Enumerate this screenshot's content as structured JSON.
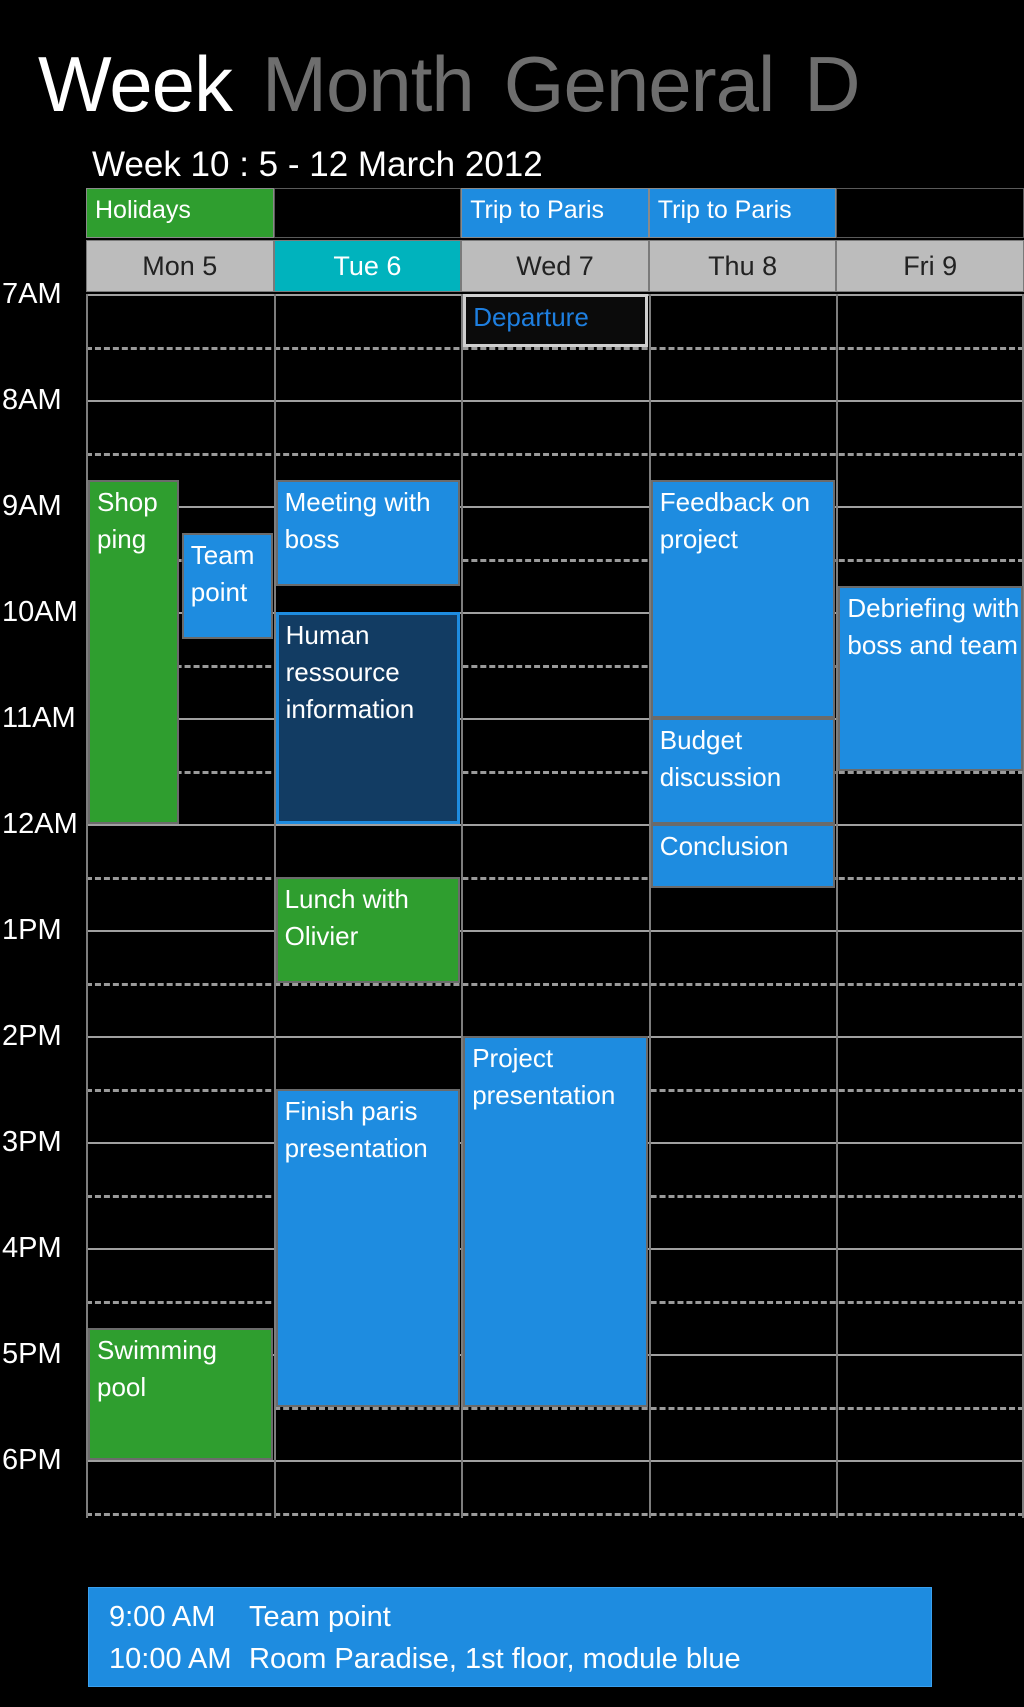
{
  "view_tabs": [
    {
      "label": "Week",
      "state": "active"
    },
    {
      "label": "Month",
      "state": "inactive"
    },
    {
      "label": "General",
      "state": "inactive"
    },
    {
      "label": "D",
      "state": "inactive"
    }
  ],
  "week_subtitle": "Week 10 : 5 - 12 March 2012",
  "colors": {
    "event_blue": "#1e8ce0",
    "event_green": "#2f9e2f",
    "event_navy": "#123c63",
    "today_highlight": "#00b3bd",
    "day_header_bg": "#bcbcbc",
    "background": "#000000"
  },
  "days": [
    {
      "label": "Mon 5",
      "today": false
    },
    {
      "label": "Tue 6",
      "today": true
    },
    {
      "label": "Wed 7",
      "today": false
    },
    {
      "label": "Thu 8",
      "today": false
    },
    {
      "label": "Fri 9",
      "today": false
    }
  ],
  "allday_events": [
    {
      "label": "Holidays",
      "day": 0,
      "color": "green"
    },
    {
      "label": "",
      "day": 1,
      "color": "empty"
    },
    {
      "label": "Trip to Paris",
      "day": 2,
      "color": "blue"
    },
    {
      "label": "Trip to Paris",
      "day": 3,
      "color": "blue"
    },
    {
      "label": "",
      "day": 4,
      "color": "empty"
    }
  ],
  "hours": [
    {
      "label": "7AM",
      "index": 0
    },
    {
      "label": "8AM",
      "index": 1
    },
    {
      "label": "9AM",
      "index": 2
    },
    {
      "label": "10AM",
      "index": 3
    },
    {
      "label": "11AM",
      "index": 4
    },
    {
      "label": "12AM",
      "index": 5
    },
    {
      "label": "1PM",
      "index": 6
    },
    {
      "label": "2PM",
      "index": 7
    },
    {
      "label": "3PM",
      "index": 8
    },
    {
      "label": "4PM",
      "index": 9
    },
    {
      "label": "5PM",
      "index": 10
    },
    {
      "label": "6PM",
      "index": 11
    }
  ],
  "events": [
    {
      "title": "Shop ping",
      "day": 0,
      "start": 8.75,
      "end": 12.0,
      "style": "green",
      "lane": 0,
      "lanes": 2
    },
    {
      "title": "Team point",
      "day": 0,
      "start": 9.25,
      "end": 10.25,
      "style": "blue",
      "lane": 1,
      "lanes": 2
    },
    {
      "title": "Swimming pool",
      "day": 0,
      "start": 16.75,
      "end": 18.0,
      "style": "green",
      "lane": 0,
      "lanes": 1
    },
    {
      "title": "Meeting with boss",
      "day": 1,
      "start": 8.75,
      "end": 9.75,
      "style": "blue",
      "lane": 0,
      "lanes": 1
    },
    {
      "title": "Human ressource information",
      "day": 1,
      "start": 10.0,
      "end": 12.0,
      "style": "navy",
      "lane": 0,
      "lanes": 1
    },
    {
      "title": "Lunch with Olivier",
      "day": 1,
      "start": 12.5,
      "end": 13.5,
      "style": "green",
      "lane": 0,
      "lanes": 1
    },
    {
      "title": "Finish paris presentation",
      "day": 1,
      "start": 14.5,
      "end": 17.5,
      "style": "blue",
      "lane": 0,
      "lanes": 1
    },
    {
      "title": "Departure",
      "day": 2,
      "start": 7.0,
      "end": 7.5,
      "style": "outline",
      "lane": 0,
      "lanes": 1
    },
    {
      "title": "Project presentation",
      "day": 2,
      "start": 14.0,
      "end": 17.5,
      "style": "blue",
      "lane": 0,
      "lanes": 1
    },
    {
      "title": "Feedback on project",
      "day": 3,
      "start": 8.75,
      "end": 11.0,
      "style": "blue",
      "lane": 0,
      "lanes": 1
    },
    {
      "title": "Budget discussion",
      "day": 3,
      "start": 11.0,
      "end": 12.0,
      "style": "blue",
      "lane": 0,
      "lanes": 1
    },
    {
      "title": "Conclusion",
      "day": 3,
      "start": 12.0,
      "end": 12.6,
      "style": "blue",
      "lane": 0,
      "lanes": 1
    },
    {
      "title": "Debriefing with boss and team",
      "day": 4,
      "start": 9.75,
      "end": 11.5,
      "style": "blue",
      "lane": 0,
      "lanes": 1
    }
  ],
  "detail_bar": {
    "lines": [
      {
        "time": "9:00 AM",
        "text": "Team point"
      },
      {
        "time": "10:00 AM",
        "text": "Room Paradise, 1st floor, module blue"
      }
    ]
  }
}
